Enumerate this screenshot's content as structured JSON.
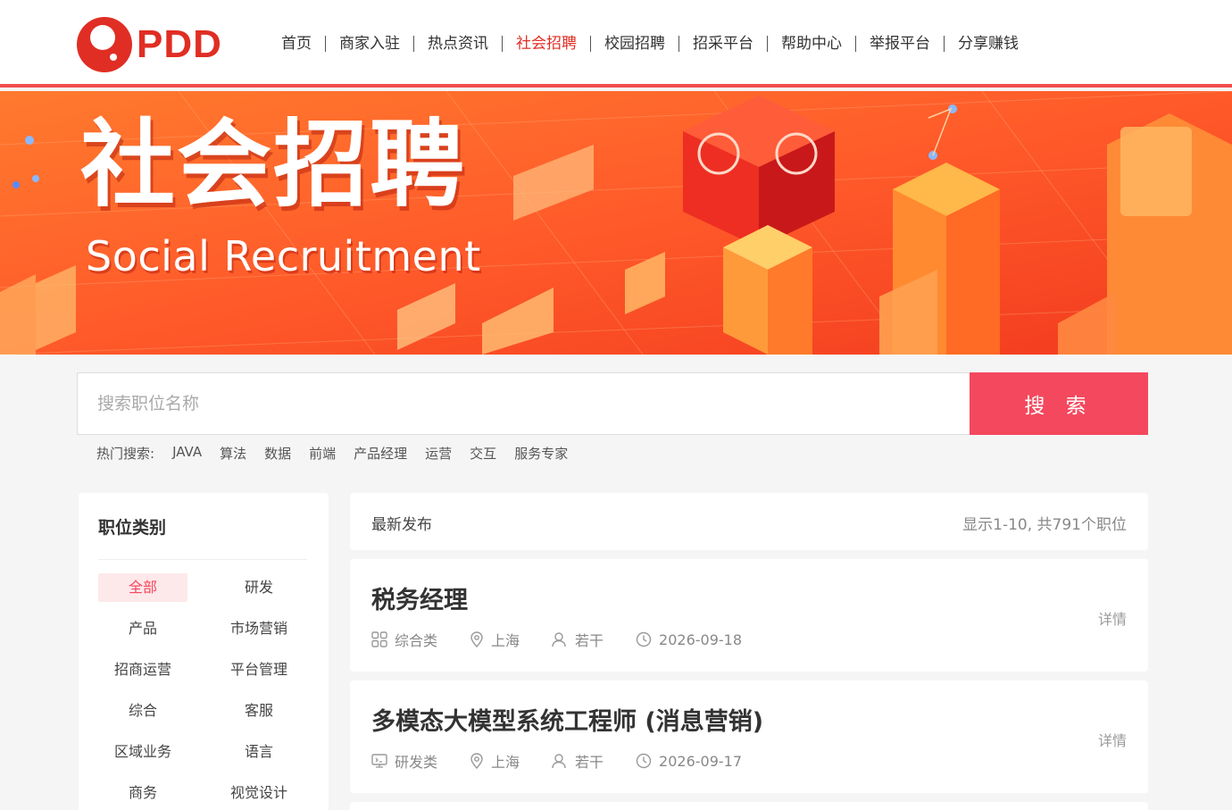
{
  "header": {
    "logo_text": "PDD",
    "nav": [
      {
        "label": "首页"
      },
      {
        "label": "商家入驻"
      },
      {
        "label": "热点资讯"
      },
      {
        "label": "社会招聘",
        "active": true
      },
      {
        "label": "校园招聘"
      },
      {
        "label": "招采平台"
      },
      {
        "label": "帮助中心"
      },
      {
        "label": "举报平台"
      },
      {
        "label": "分享赚钱"
      }
    ]
  },
  "banner": {
    "title": "社会招聘",
    "subtitle": "Social Recruitment"
  },
  "search": {
    "placeholder": "搜索职位名称",
    "button_label": "搜 索",
    "hot_label": "热门搜索:",
    "hot_terms": [
      "JAVA",
      "算法",
      "数据",
      "前端",
      "产品经理",
      "运营",
      "交互",
      "服务专家"
    ]
  },
  "sidebar": {
    "title": "职位类别",
    "categories": [
      "全部",
      "研发",
      "产品",
      "市场营销",
      "招商运营",
      "平台管理",
      "综合",
      "客服",
      "区域业务",
      "语言",
      "商务",
      "视觉设计"
    ],
    "selected": "全部"
  },
  "list": {
    "title": "最新发布",
    "count_text": "显示1-10, 共791个职位",
    "jobs": [
      {
        "title": "税务经理",
        "category": "综合类",
        "category_icon": "grid-icon",
        "location": "上海",
        "headcount": "若干",
        "date": "2026-09-18",
        "detail": "详情"
      },
      {
        "title": "多模态大模型系统工程师 (消息营销)",
        "category": "研发类",
        "category_icon": "monitor-icon",
        "location": "上海",
        "headcount": "若干",
        "date": "2026-09-17",
        "detail": "详情"
      }
    ]
  },
  "colors": {
    "brand_red": "#e02e24",
    "accent_pink": "#f4485e",
    "banner_orange": "#ff6a2a"
  }
}
